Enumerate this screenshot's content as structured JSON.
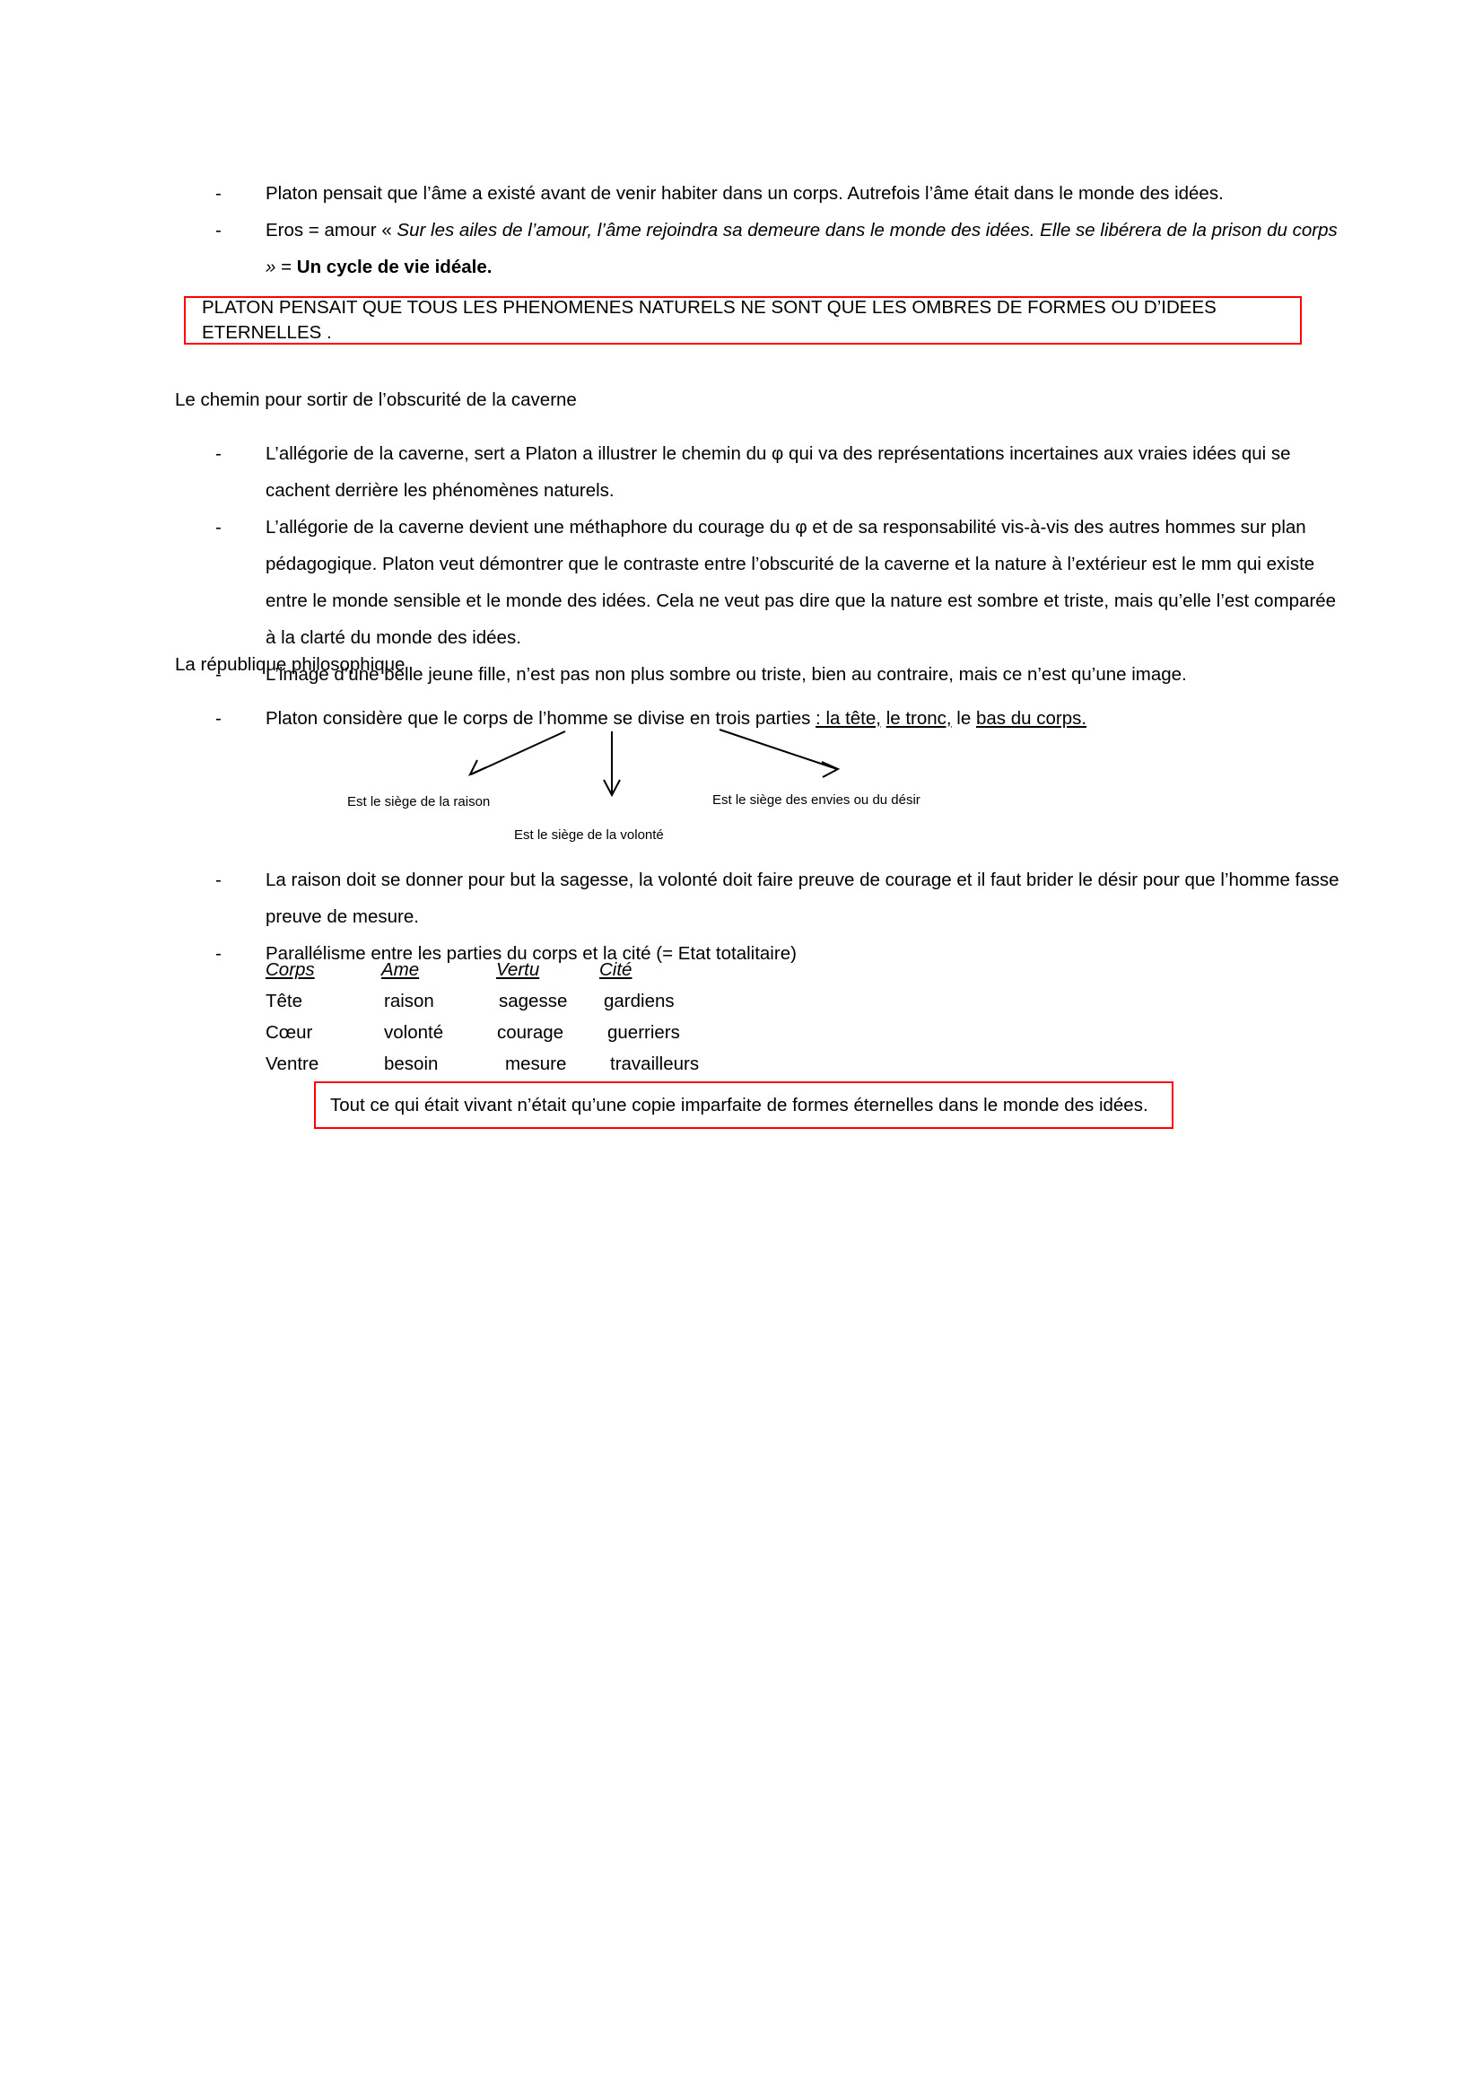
{
  "document": {
    "language": "fr",
    "accent_red": "#ff0000",
    "text_color": "#000000",
    "background": "#ffffff"
  },
  "intro_bullets": [
    {
      "marker": "-",
      "segments": [
        {
          "text": "Platon pensait que l’âme a existé avant de venir habiter dans un corps. Autrefois l’âme était dans le monde des idées.",
          "style": "normal"
        }
      ]
    },
    {
      "marker": "-",
      "segments": [
        {
          "text": "Eros = amour « ",
          "style": "normal"
        },
        {
          "text": " Sur les ailes de l’amour, l’âme rejoindra sa demeure dans le monde des idées. Elle se libérera de la prison du corps »",
          "style": "italic"
        },
        {
          "text": " = ",
          "style": "normal"
        },
        {
          "text": "Un cycle de vie idéale.",
          "style": "bold"
        }
      ]
    }
  ],
  "callout_1": {
    "text": "PLATON PENSAIT QUE TOUS LES PHENOMENES NATURELS NE SONT QUE LES OMBRES DE  FORMES OU D’IDEES ETERNELLES ."
  },
  "section_1": {
    "heading": "Le chemin pour sortir de l’obscurité de la caverne",
    "bullets": [
      {
        "marker": "-",
        "text": "L’allégorie de la caverne, sert a Platon a illustrer le chemin du φ qui va des représentations incertaines aux vraies idées qui se cachent derrière les phénomènes naturels."
      },
      {
        "marker": "-",
        "text": "L’allégorie de la caverne devient une méthaphore du courage du φ et de sa responsabilité vis-à-vis des autres hommes sur plan pédagogique. Platon veut démontrer que le contraste entre l’obscurité de la caverne et la nature à l’extérieur est le mm qui existe entre le monde sensible et le monde des idées. Cela ne veut pas dire que la nature est sombre et triste, mais qu’elle l’est comparée à la clarté du monde des idées."
      },
      {
        "marker": "-",
        "text": "L’image d’une belle jeune fille, n’est pas non plus sombre ou triste, bien au contraire, mais ce n’est qu’une image."
      }
    ]
  },
  "section_2": {
    "heading": "La république philosophique",
    "bullet_divise": {
      "marker": "-",
      "lead": "Platon considère que le corps de l’homme se divise en trois parties ",
      "parts": [
        {
          "text": ": la tête,",
          "underline": true
        },
        {
          "text": " ",
          "underline": false
        },
        {
          "text": "le tronc,",
          "underline": true
        },
        {
          "text": " le ",
          "underline": false
        },
        {
          "text": "bas du corps.",
          "underline": true
        }
      ]
    },
    "diagram": {
      "label_left": "Est le siège de la raison",
      "label_center": "Est le siège de la volonté",
      "label_right": "Est le siège des envies ou du désir"
    },
    "bullets_after": [
      {
        "marker": "-",
        "text": "La raison doit se donner pour but la sagesse, la volonté doit faire preuve de courage et il faut brider le désir pour que l’homme fasse preuve de mesure."
      },
      {
        "marker": "-",
        "text": "Parallélisme entre les parties du corps et la cité (= Etat totalitaire)"
      }
    ],
    "table": {
      "headers": [
        "Corps",
        "Ame",
        "Vertu ",
        "Cité"
      ],
      "rows": [
        [
          "Tête",
          "raison",
          "sagesse",
          "gardiens"
        ],
        [
          "Cœur",
          "volonté",
          "courage",
          "guerriers"
        ],
        [
          "Ventre",
          "besoin",
          "mesure",
          "travailleurs"
        ]
      ]
    }
  },
  "callout_2": {
    "text": "Tout ce qui était vivant n’était qu’une copie imparfaite de formes éternelles dans le monde des idées."
  }
}
